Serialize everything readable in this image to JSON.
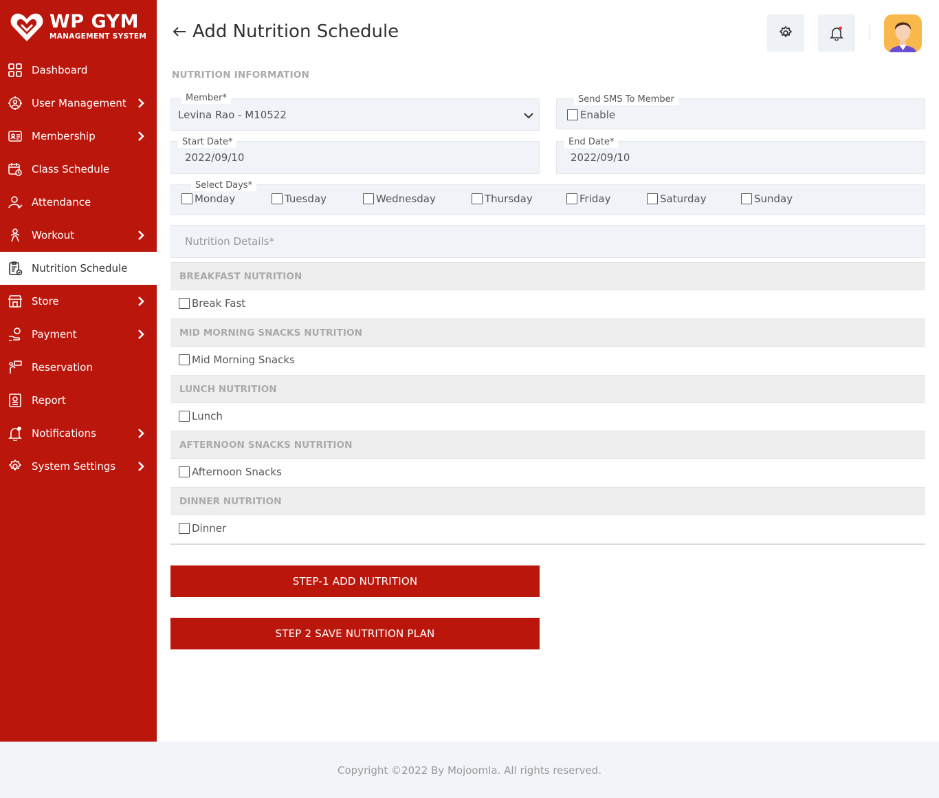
{
  "brand": {
    "title": "WP GYM",
    "subtitle": "MANAGEMENT SYSTEM"
  },
  "sidebar": {
    "items": [
      {
        "label": "Dashboard",
        "icon": "dashboard-grid-icon",
        "has_submenu": false
      },
      {
        "label": "User Management",
        "icon": "users-gear-icon",
        "has_submenu": true
      },
      {
        "label": "Membership",
        "icon": "id-card-icon",
        "has_submenu": true
      },
      {
        "label": "Class Schedule",
        "icon": "calendar-icon",
        "has_submenu": false
      },
      {
        "label": "Attendance",
        "icon": "user-check-icon",
        "has_submenu": false
      },
      {
        "label": "Workout",
        "icon": "workout-icon",
        "has_submenu": true
      },
      {
        "label": "Nutrition Schedule",
        "icon": "clipboard-icon",
        "has_submenu": false,
        "active": true
      },
      {
        "label": "Store",
        "icon": "store-icon",
        "has_submenu": true
      },
      {
        "label": "Payment",
        "icon": "payment-hand-icon",
        "has_submenu": true
      },
      {
        "label": "Reservation",
        "icon": "reservation-icon",
        "has_submenu": false
      },
      {
        "label": "Report",
        "icon": "report-icon",
        "has_submenu": false
      },
      {
        "label": "Notifications",
        "icon": "bell-icon",
        "has_submenu": true
      },
      {
        "label": "System Settings",
        "icon": "gear-icon",
        "has_submenu": true
      }
    ]
  },
  "header": {
    "title": "Add Nutrition Schedule",
    "icons": [
      "back-arrow-icon",
      "gear-icon",
      "bell-icon",
      "avatar"
    ],
    "notification_dot_color": "#e53935"
  },
  "form": {
    "section_title": "NUTRITION INFORMATION",
    "member": {
      "label": "Member*",
      "value": "Levina Rao - M10522"
    },
    "sms": {
      "label": "Send SMS To Member",
      "option": "Enable",
      "checked": false
    },
    "start_date": {
      "label": "Start Date*",
      "value": "2022/09/10"
    },
    "end_date": {
      "label": "End Date*",
      "value": "2022/09/10"
    },
    "days": {
      "label": "Select Days*",
      "options": [
        "Monday",
        "Tuesday",
        "Wednesday",
        "Thursday",
        "Friday",
        "Saturday",
        "Sunday"
      ]
    },
    "nutrition_details_placeholder": "Nutrition Details*",
    "sections": [
      {
        "title": "BREAKFAST NUTRITION",
        "option": "Break Fast"
      },
      {
        "title": "MID MORNING SNACKS NUTRITION",
        "option": "Mid Morning Snacks"
      },
      {
        "title": "LUNCH NUTRITION",
        "option": "Lunch"
      },
      {
        "title": "AFTERNOON SNACKS NUTRITION",
        "option": "Afternoon Snacks"
      },
      {
        "title": "DINNER NUTRITION",
        "option": "Dinner"
      }
    ],
    "buttons": {
      "step1": "STEP-1 ADD NUTRITION",
      "step2": "STEP 2 SAVE NUTRITION PLAN"
    }
  },
  "footer": {
    "text": "Copyright ©2022 By Mojoomla. All rights reserved."
  },
  "colors": {
    "primary": "#bb160c",
    "field_bg": "#f0f3f8",
    "band_bg": "#eeeeee",
    "footer_bg": "#f1f4f9"
  }
}
